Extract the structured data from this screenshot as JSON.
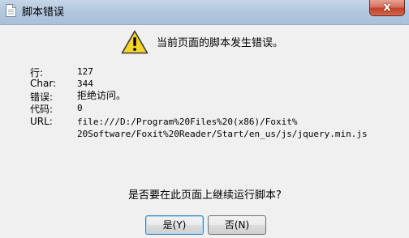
{
  "window": {
    "title": "脚本错误",
    "close_label": "x"
  },
  "message": "当前页面的脚本发生错误。",
  "details": {
    "line_label": "行:",
    "line_value": "127",
    "char_label": "Char:",
    "char_value": "344",
    "error_label": "错误:",
    "error_value": "拒绝访问。",
    "code_label": "代码:",
    "code_value": "0",
    "url_label": "URL:",
    "url_value_line1": "file:///D:/Program%20Files%20(x86)/Foxit%",
    "url_value_line2": "20Software/Foxit%20Reader/Start/en_us/js/jquery.min.js"
  },
  "question": "是否要在此页面上继续运行脚本?",
  "buttons": {
    "yes_label": "是(Y)",
    "no_label": "否(N)"
  },
  "icons": {
    "title_icon": "document-icon",
    "warning_icon": "warning-icon"
  },
  "colors": {
    "warning_yellow": "#f5d52a",
    "close_red": "#c2412a"
  }
}
